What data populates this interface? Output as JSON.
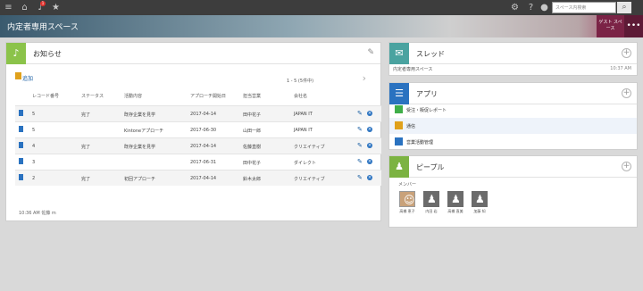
{
  "topbar": {
    "notification_count": "1",
    "search_placeholder": "スペース内検索"
  },
  "space": {
    "title": "内定者専用スペース",
    "guest_label": "ゲスト スペース",
    "more_label": "•••"
  },
  "announcement": {
    "title": "お知らせ",
    "new_link": "追加",
    "pager": "1 - 5 (5件中)",
    "columns": [
      "レコード番号",
      "ステータス",
      "活動内容",
      "アプローチ開始日",
      "担当営業",
      "会社名"
    ],
    "rows": [
      {
        "id": "5",
        "status": "完了",
        "activity": "既存企業を見学",
        "date": "2017-04-14",
        "owner": "田中花子",
        "company": "JAPAN IT",
        "alt": true
      },
      {
        "id": "5",
        "status": "",
        "activity": "Kintoneアプローチ",
        "date": "2017-06-30",
        "owner": "山田一郎",
        "company": "JAPAN IT",
        "alt": false
      },
      {
        "id": "4",
        "status": "完了",
        "activity": "既存企業を見学",
        "date": "2017-04-14",
        "owner": "佐藤直樹",
        "company": "クリエイティブ",
        "alt": true
      },
      {
        "id": "3",
        "status": "",
        "activity": "",
        "date": "2017-06-31",
        "owner": "田中花子",
        "company": "ダイレクト",
        "alt": false
      },
      {
        "id": "2",
        "status": "完了",
        "activity": "初回アプローチ",
        "date": "2017-04-14",
        "owner": "鈴木太郎",
        "company": "クリエイティブ",
        "alt": true
      }
    ],
    "footer": "10:36 AM  佐藤  m"
  },
  "thread": {
    "title": "スレッド",
    "item_text": "内定者専用スペース",
    "item_time": "10:37 AM"
  },
  "apps": {
    "title": "アプリ",
    "items": [
      {
        "label": "受注・販促レポート",
        "color": "#3fae49"
      },
      {
        "label": "通信",
        "color": "#e0a11b"
      },
      {
        "label": "営業活動管理",
        "color": "#2a72c0"
      }
    ]
  },
  "people": {
    "title": "ピープル",
    "members_label": "メンバー",
    "members": [
      {
        "name": "高橋 恵子"
      },
      {
        "name": "内田 岩"
      },
      {
        "name": "高橋 直美"
      },
      {
        "name": "加藤 知"
      }
    ]
  },
  "colors": {
    "announce_icon": "#8bc34a",
    "thread_icon": "#4aa3a0",
    "apps_icon": "#2a72c0",
    "people_icon": "#7cb342"
  }
}
